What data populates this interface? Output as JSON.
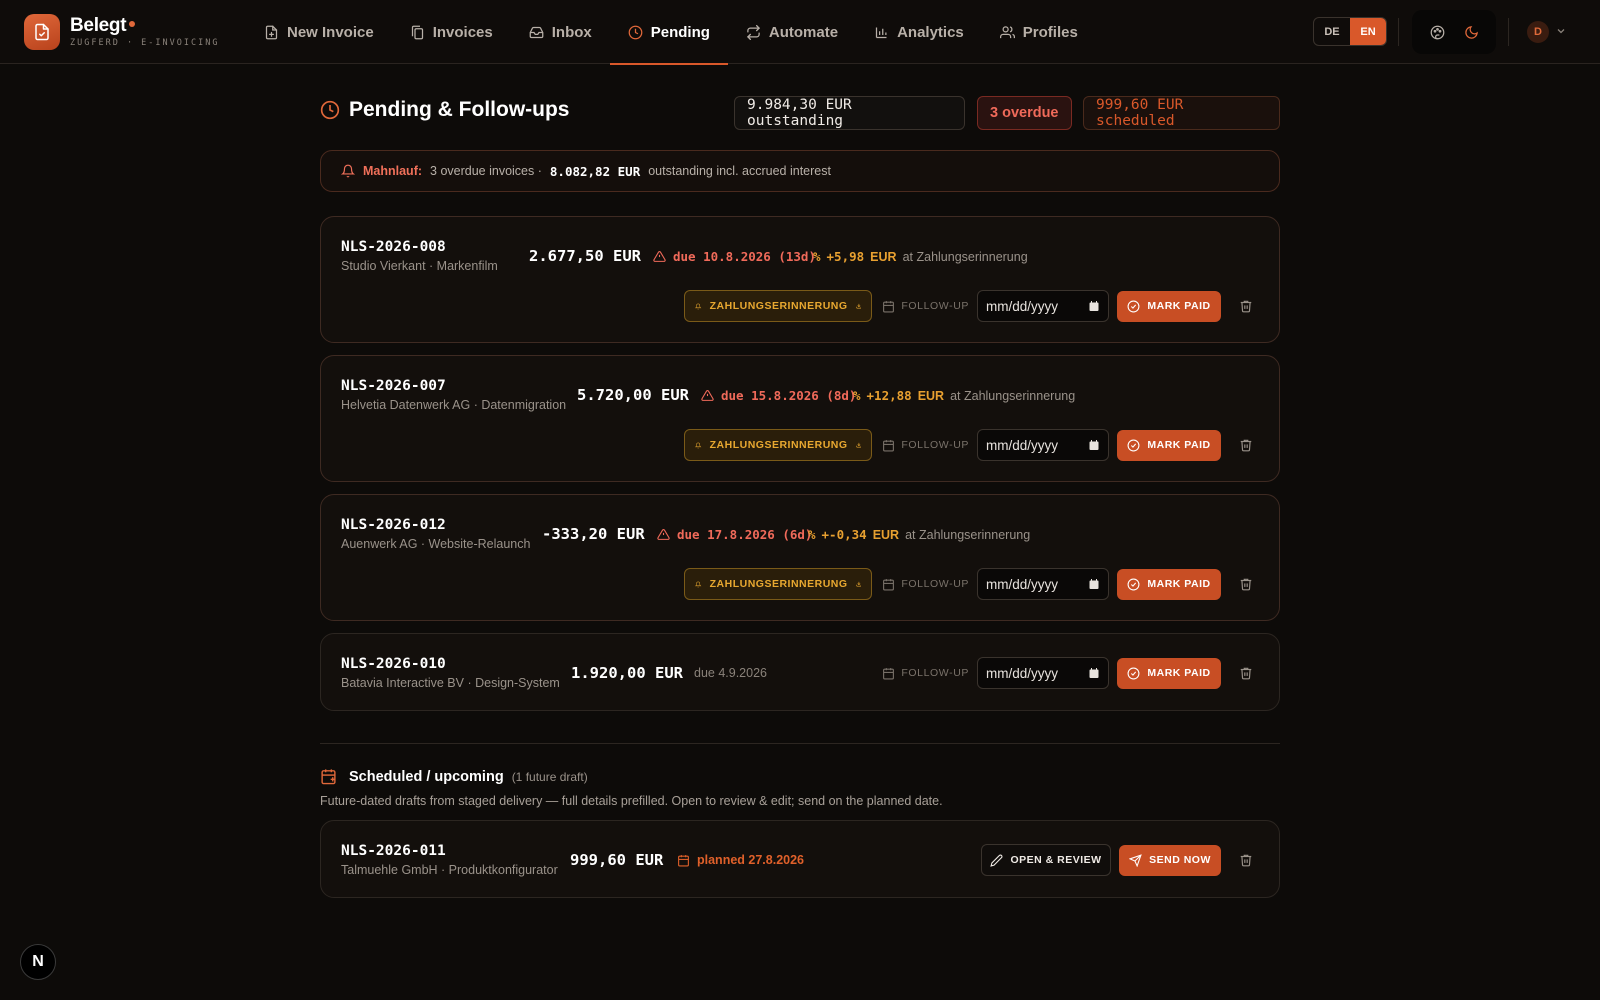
{
  "app": {
    "name": "Belegt",
    "subtitle": "ZUGFERD · E-INVOICING"
  },
  "nav": [
    {
      "label": "New Invoice",
      "icon": "file-plus-icon"
    },
    {
      "label": "Invoices",
      "icon": "files-icon"
    },
    {
      "label": "Inbox",
      "icon": "inbox-icon"
    },
    {
      "label": "Pending",
      "icon": "clock-icon",
      "active": true
    },
    {
      "label": "Automate",
      "icon": "repeat-icon"
    },
    {
      "label": "Analytics",
      "icon": "bar-chart-icon"
    },
    {
      "label": "Profiles",
      "icon": "users-icon"
    }
  ],
  "lang": {
    "de": "DE",
    "en": "EN",
    "active": "EN"
  },
  "user": {
    "initial": "D"
  },
  "page": {
    "title": "Pending & Follow-ups",
    "outstanding": "9.984,30 EUR outstanding",
    "overdue": "3 overdue",
    "scheduled": "999,60 EUR scheduled"
  },
  "mahnlauf": {
    "label": "Mahnlauf:",
    "count_text": "3 overdue invoices ·",
    "amount": "8.082,82 EUR",
    "suffix": "outstanding incl. accrued interest"
  },
  "labels": {
    "reminder": "ZAHLUNGSERINNERUNG",
    "followup": "FOLLOW-UP",
    "date_placeholder": "mm/dd/yyyy",
    "mark_paid": "MARK PAID",
    "open_review": "OPEN & REVIEW",
    "send_now": "SEND NOW"
  },
  "invoices": [
    {
      "no": "NLS-2026-008",
      "client": "Studio Vierkant · Markenfilm",
      "amount": "2.677,50 EUR",
      "due": "due 10.8.2026 (13d)",
      "interest": "+5,98",
      "currency": "EUR",
      "interest_suffix": "at Zahlungserinnerung"
    },
    {
      "no": "NLS-2026-007",
      "client": "Helvetia Datenwerk AG · Datenmigration",
      "amount": "5.720,00 EUR",
      "due": "due 15.8.2026 (8d)",
      "interest": "+12,88",
      "currency": "EUR",
      "interest_suffix": "at Zahlungserinnerung"
    },
    {
      "no": "NLS-2026-012",
      "client": "Auenwerk AG · Website-Relaunch",
      "amount": "-333,20 EUR",
      "due": "due 17.8.2026 (6d)",
      "interest": "+-0,34",
      "currency": "EUR",
      "interest_suffix": "at Zahlungserinnerung"
    },
    {
      "no": "NLS-2026-010",
      "client": "Batavia Interactive BV · Design-System",
      "amount": "1.920,00 EUR",
      "due": "due 4.9.2026"
    }
  ],
  "scheduled": {
    "title": "Scheduled / upcoming",
    "count": "(1 future draft)",
    "description": "Future-dated drafts from staged delivery — full details prefilled. Open to review & edit; send on the planned date.",
    "item": {
      "no": "NLS-2026-011",
      "client": "Talmuehle GmbH · Produktkonfigurator",
      "amount": "999,60 EUR",
      "planned": "planned 27.8.2026"
    }
  },
  "colors": {
    "accent": "#d9582a",
    "danger": "#f06a5a",
    "warning": "#e8a830",
    "background": "#0d0b09"
  },
  "badge": {
    "label": "N"
  }
}
